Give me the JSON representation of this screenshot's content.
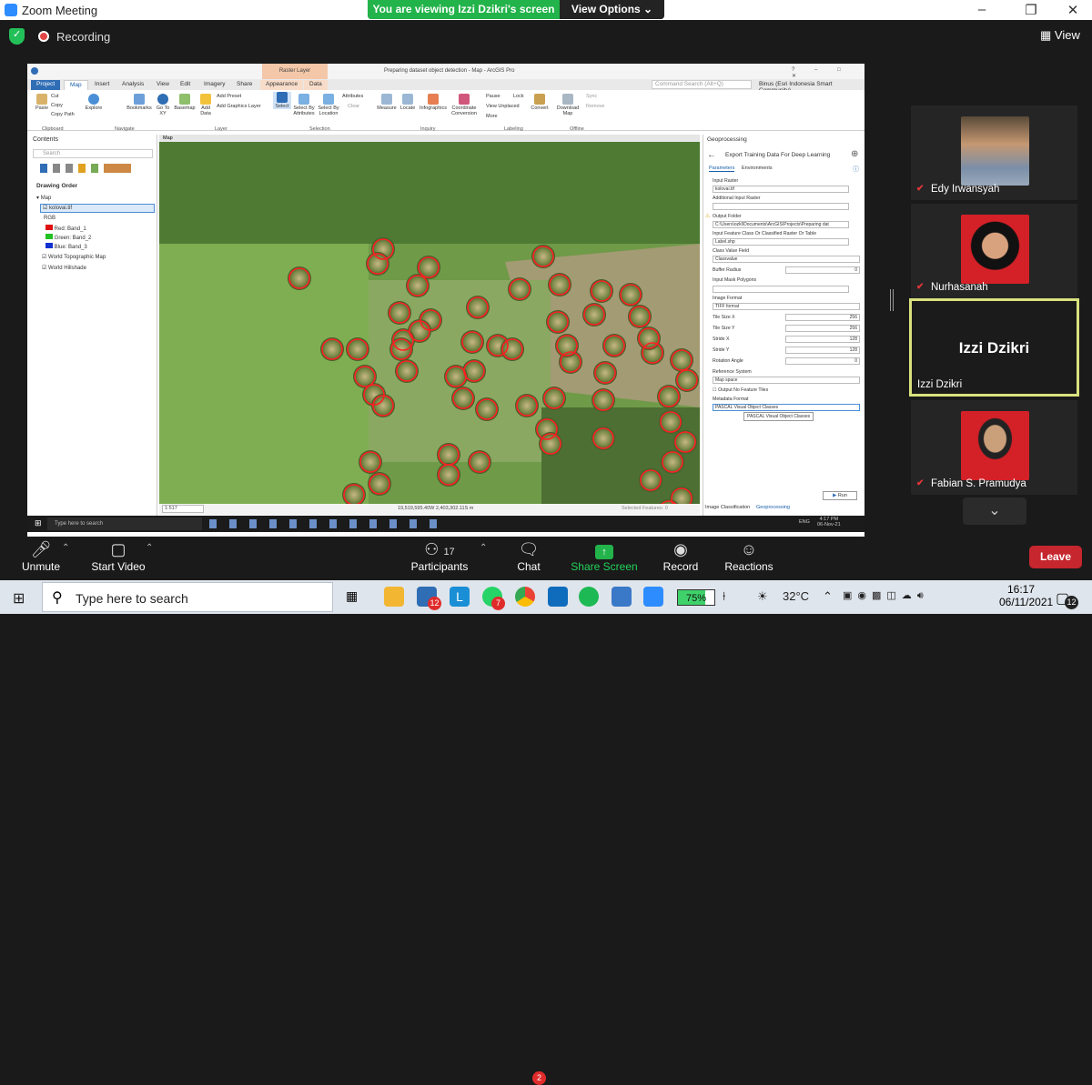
{
  "zoom": {
    "window_title": "Zoom Meeting",
    "viewing_banner": "You are viewing Izzi Dzikri's screen",
    "view_options": "View Options ⌄",
    "recording_label": "Recording",
    "view_label": "View",
    "participants": [
      {
        "name": "Edy Irwansyah",
        "muted": true
      },
      {
        "name": "Nurhasanah",
        "muted": true
      },
      {
        "name": "Izzi Dzikri",
        "big_label": "Izzi Dzikri",
        "active": true
      },
      {
        "name": "Fabian S. Pramudya",
        "muted": true
      }
    ],
    "toolbar": {
      "unmute": "Unmute",
      "start_video": "Start Video",
      "participants": "Participants",
      "participants_count": "17",
      "chat": "Chat",
      "chat_badge": "2",
      "share_screen": "Share Screen",
      "record": "Record",
      "reactions": "Reactions",
      "leave": "Leave"
    },
    "colors": {
      "accent_green": "#22b34a",
      "leave_red": "#c6262e",
      "active_border": "#d9e27e"
    }
  },
  "arcgis": {
    "title": "Preparing dataset object detection - Map - ArcGIS Pro",
    "contextual_tab": "Raster Layer",
    "command_search": "Command Search (Alt+Q)",
    "user": "Binus (Esri Indonesia Smart Community)",
    "tabs": [
      "Project",
      "Map",
      "Insert",
      "Analysis",
      "View",
      "Edit",
      "Imagery",
      "Share",
      "Appearance",
      "Data"
    ],
    "ribbon": {
      "clipboard": {
        "label": "Clipboard",
        "items": [
          "Paste",
          "Cut",
          "Copy",
          "Copy Path"
        ]
      },
      "navigate": {
        "label": "Navigate",
        "items": [
          "Explore",
          "Bookmarks",
          "Go To XY"
        ]
      },
      "layer": {
        "label": "Layer",
        "items": [
          "Basemap",
          "Add Data",
          "Add Preset",
          "Add Graphics Layer"
        ]
      },
      "selection": {
        "label": "Selection",
        "items": [
          "Select",
          "Select By Attributes",
          "Select By Location",
          "Attributes",
          "Clear"
        ]
      },
      "inquiry": {
        "label": "Inquiry",
        "items": [
          "Measure",
          "Locate",
          "Infographics",
          "Coordinate Conversion"
        ]
      },
      "labeling": {
        "label": "Labeling",
        "items": [
          "Pause",
          "View Unplaced",
          "More",
          "Lock",
          "Convert"
        ]
      },
      "offline": {
        "label": "Offline",
        "items": [
          "Download Map",
          "Sync",
          "Remove"
        ]
      }
    },
    "contents": {
      "title": "Contents",
      "search_placeholder": "Search",
      "drawing_order": "Drawing Order",
      "map": "Map",
      "layer": "kolovai.tif",
      "rgb": "RGB",
      "bands": [
        {
          "label": "Red:  Band_1",
          "color": "#e01010"
        },
        {
          "label": "Green: Band_2",
          "color": "#22c022"
        },
        {
          "label": "Blue:  Band_3",
          "color": "#1030d0"
        }
      ],
      "basemaps": [
        "World Topographic Map",
        "World Hillshade"
      ]
    },
    "map_tab": "Map",
    "status": {
      "scale": "1:517",
      "coords": "19,519,595.40W 2,403,302.11S m",
      "selected": "Selected Features: 0"
    },
    "geoprocessing": {
      "title": "Geoprocessing",
      "tool": "Export Training Data For Deep Learning",
      "tabs": [
        "Parameters",
        "Environments"
      ],
      "fields": {
        "input_raster_label": "Input Raster",
        "input_raster": "kolovai.tif",
        "additional_input_label": "Additional Input Raster",
        "output_folder_label": "Output Folder",
        "output_folder": "C:\\Users\\ozkl\\Documents\\ArcGIS\\Projects\\Preparing dat",
        "input_feature_label": "Input Feature Class Or Classified Raster Or Table",
        "input_feature": "Label.shp",
        "class_value_label": "Class Value Field",
        "class_value": "Classvalue",
        "buffer_label": "Buffer Radius",
        "buffer": "0",
        "mask_label": "Input Mask Polygons",
        "image_format_label": "Image Format",
        "image_format": "TIFF format",
        "tile_x_label": "Tile Size X",
        "tile_x": "256",
        "tile_y_label": "Tile Size Y",
        "tile_y": "256",
        "stride_x_label": "Stride X",
        "stride_x": "128",
        "stride_y_label": "Stride Y",
        "stride_y": "128",
        "rotation_label": "Rotation Angle",
        "rotation": "0",
        "reference_label": "Reference System",
        "reference": "Map space",
        "output_no_feature": "Output No Feature Tiles",
        "metadata_label": "Metadata Format",
        "metadata": "PASCAL Visual Object Classes",
        "tooltip": "PASCAL Visual Object Classes"
      },
      "run": "Run",
      "bottom_tabs": [
        "Image Classification",
        "Geoprocessing"
      ]
    },
    "inner_taskbar": {
      "search": "Type here to search",
      "time": "4:17 PM",
      "date": "06-Nov-21",
      "lang": "ENG"
    }
  },
  "windows": {
    "search_placeholder": "Type here to search",
    "battery": "75%",
    "temperature": "32°C",
    "time": "16:17",
    "date": "06/11/2021",
    "notification_count": "12",
    "mail_badge": "12",
    "app_badge": "7"
  }
}
